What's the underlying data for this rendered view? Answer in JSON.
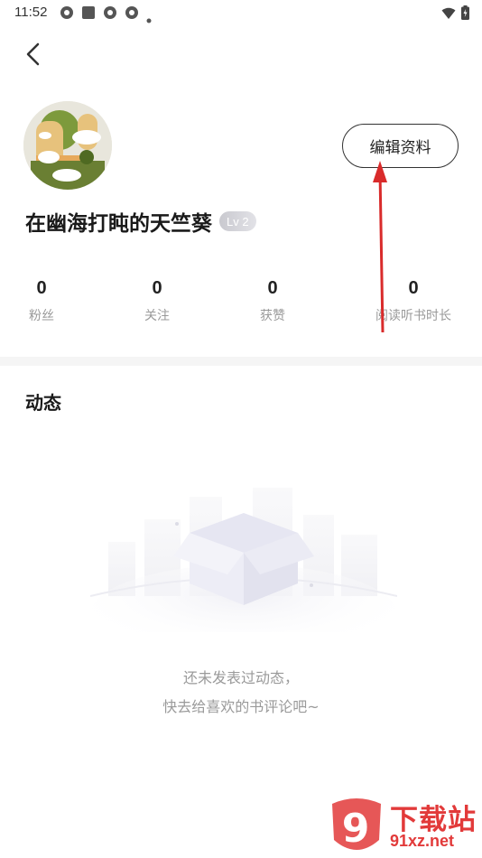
{
  "status_bar": {
    "time": "11:52",
    "left_icons": [
      "app-notification-icon",
      "square-icon",
      "app-notification-icon",
      "app-notification-icon",
      "dot-icon"
    ],
    "right_icons": [
      "wifi-icon",
      "battery-icon"
    ]
  },
  "header": {
    "back_icon": "chevron-left-icon"
  },
  "profile": {
    "username": "在幽海打盹的天竺葵",
    "level": "Lv 2",
    "edit_button_label": "编辑资料"
  },
  "stats": [
    {
      "value": "0",
      "label": "粉丝"
    },
    {
      "value": "0",
      "label": "关注"
    },
    {
      "value": "0",
      "label": "获赞"
    },
    {
      "value": "0",
      "label": "阅读听书时长"
    }
  ],
  "feed": {
    "title": "动态",
    "empty_line_1": "还未发表过动态，",
    "empty_line_2": "快去给喜欢的书评论吧~"
  },
  "watermark": {
    "logo_text": "9",
    "line_1": "下载站",
    "line_2": "91xz.net"
  },
  "colors": {
    "accent_red": "#e23a3a",
    "text_primary": "#222222",
    "text_secondary": "#999999"
  }
}
